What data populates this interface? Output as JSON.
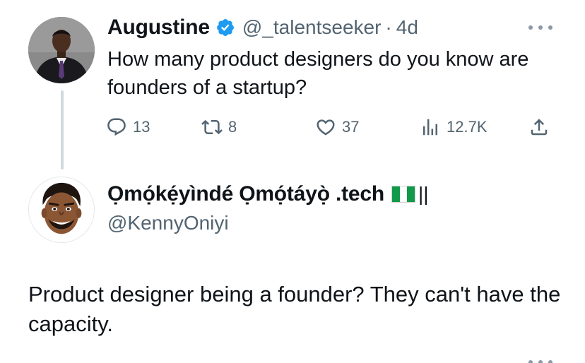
{
  "tweet": {
    "author_name": "Augustine",
    "handle": "@_talentseeker",
    "separator": "·",
    "time": "4d",
    "text": "How many product designers do you know are founders of a startup?",
    "stats": {
      "replies": "13",
      "reposts": "8",
      "likes": "37",
      "views": "12.7K"
    }
  },
  "reply": {
    "author_name": "Ọmọ́kẹ́yìndé Ọmọ́táyọ̀ .tech",
    "name_suffix": "||",
    "handle": "@KennyOniyi",
    "text": "Product designer being a founder? They can't have the capacity."
  },
  "icons": {
    "verified": "verified-badge-icon",
    "reply": "reply-bubble-icon",
    "repost": "repost-icon",
    "like": "heart-icon",
    "views": "views-bar-chart-icon",
    "share": "share-upload-icon",
    "more": "more-dots-icon",
    "flag": "nigeria-flag-icon"
  },
  "colors": {
    "text_primary": "#0f1419",
    "text_secondary": "#536471",
    "verified_blue": "#1d9bf0",
    "thread_line": "#cfd9de",
    "flag_green": "#119a4a"
  }
}
